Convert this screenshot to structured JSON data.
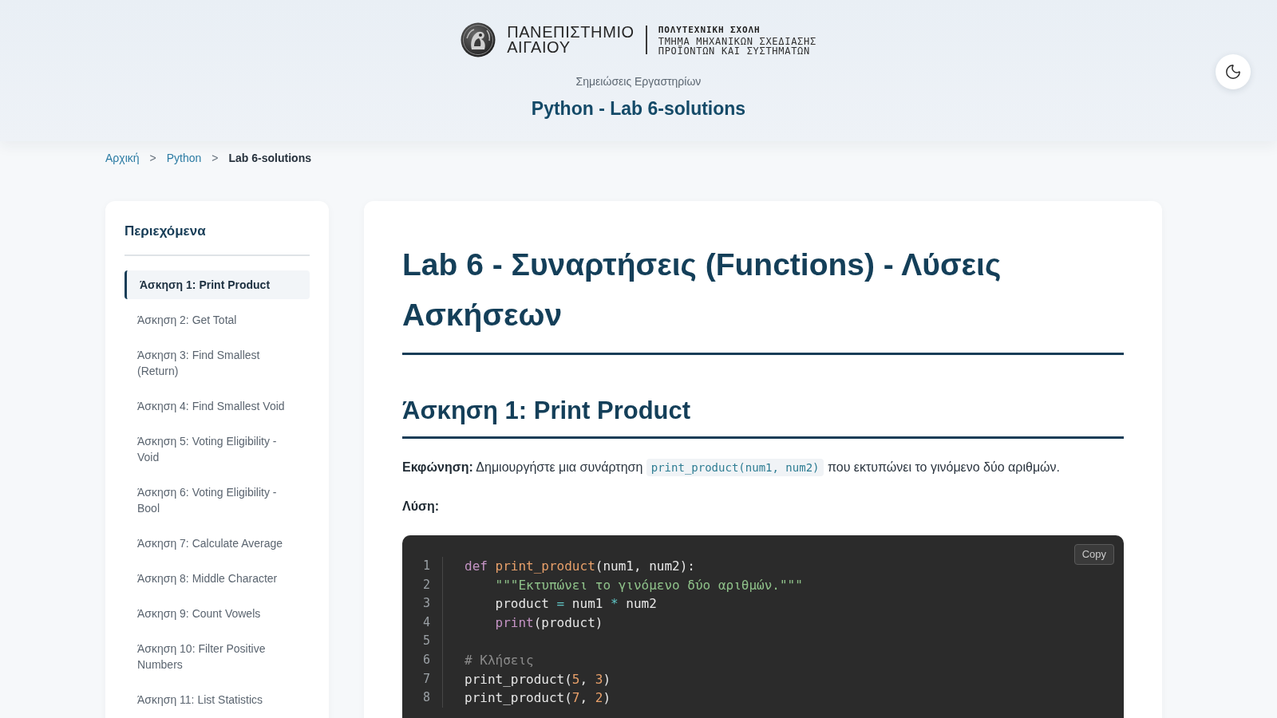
{
  "header": {
    "logo": {
      "name_lines": [
        "ΠΑΝΕΠΙΣΤΗΜΙΟ",
        "ΑΙΓΑΙΟΥ"
      ],
      "school": "ΠΟΛΥΤΕΧΝΙΚΗ ΣΧΟΛΗ",
      "department_lines": [
        "ΤΜΗΜΑ ΜΗΧΑΝΙΚΩΝ ΣΧΕΔΙΑΣΗΣ",
        "ΠΡΟΪΟΝΤΩΝ ΚΑΙ ΣΥΣΤΗΜΑΤΩΝ"
      ]
    },
    "subtitle": "Σημειώσεις Εργαστηρίων",
    "title": "Python - Lab 6-solutions"
  },
  "breadcrumb": [
    {
      "kind": "link",
      "label": "Αρχική"
    },
    {
      "kind": "separator",
      "label": ">"
    },
    {
      "kind": "link",
      "label": "Python"
    },
    {
      "kind": "separator",
      "label": ">"
    },
    {
      "kind": "current",
      "label": "Lab 6-solutions"
    }
  ],
  "sidebar": {
    "title": "Περιεχόμενα",
    "items": [
      {
        "label": "Άσκηση 1: Print Product",
        "selected": true
      },
      {
        "label": "Άσκηση 2: Get Total",
        "selected": false
      },
      {
        "label": "Άσκηση 3: Find Smallest (Return)",
        "selected": false
      },
      {
        "label": "Άσκηση 4: Find Smallest Void",
        "selected": false
      },
      {
        "label": "Άσκηση 5: Voting Eligibility - Void",
        "selected": false
      },
      {
        "label": "Άσκηση 6: Voting Eligibility - Bool",
        "selected": false
      },
      {
        "label": "Άσκηση 7: Calculate Average",
        "selected": false
      },
      {
        "label": "Άσκηση 8: Middle Character",
        "selected": false
      },
      {
        "label": "Άσκηση 9: Count Vowels",
        "selected": false
      },
      {
        "label": "Άσκηση 10: Filter Positive Numbers",
        "selected": false
      },
      {
        "label": "Άσκηση 11: List Statistics",
        "selected": false
      }
    ]
  },
  "article": {
    "title": "Lab 6 - Συναρτήσεις (Functions) - Λύσεις Ασκήσεων",
    "section": {
      "title": "Άσκηση 1: Print Product",
      "task": [
        {
          "kind": "label",
          "text": "Εκφώνηση:"
        },
        {
          "kind": "text",
          "text": "Δημιουργήστε μια συνάρτηση"
        },
        {
          "kind": "code",
          "text": "print_product(num1, num2)"
        },
        {
          "kind": "text",
          "text": "που εκτυπώνει το γινόμενο δύο αριθμών."
        }
      ],
      "solution_label": "Λύση:",
      "code": {
        "copy_button": "Copy",
        "lines": [
          {
            "number": "1",
            "tokens": [
              {
                "kind": "keyword",
                "text": "def"
              },
              {
                "kind": "function",
                "text": " print_product"
              },
              {
                "kind": "plain",
                "text": "(num1, num2):"
              }
            ]
          },
          {
            "number": "2",
            "tokens": [
              {
                "kind": "string",
                "text": "    \"\"\"Εκτυπώνει το γινόμενο δύο αριθμών.\"\"\""
              }
            ]
          },
          {
            "number": "3",
            "tokens": [
              {
                "kind": "plain",
                "text": "    product"
              },
              {
                "kind": "operator",
                "text": " ="
              },
              {
                "kind": "plain",
                "text": " num1"
              },
              {
                "kind": "operator",
                "text": " *"
              },
              {
                "kind": "plain",
                "text": " num2"
              }
            ]
          },
          {
            "number": "4",
            "tokens": [
              {
                "kind": "builtin",
                "text": "    print"
              },
              {
                "kind": "plain",
                "text": "(product)"
              }
            ]
          },
          {
            "number": "5"
          },
          {
            "number": "6",
            "tokens": [
              {
                "kind": "comment",
                "text": "# Κλήσεις"
              }
            ]
          },
          {
            "number": "7",
            "tokens": [
              {
                "kind": "plain",
                "text": "print_product("
              },
              {
                "kind": "number",
                "text": "5"
              },
              {
                "kind": "plain",
                "text": ", "
              },
              {
                "kind": "number",
                "text": "3"
              },
              {
                "kind": "plain",
                "text": ")"
              }
            ]
          },
          {
            "number": "8",
            "tokens": [
              {
                "kind": "plain",
                "text": "print_product("
              },
              {
                "kind": "number",
                "text": "7"
              },
              {
                "kind": "plain",
                "text": ", "
              },
              {
                "kind": "number",
                "text": "2"
              },
              {
                "kind": "plain",
                "text": ")"
              }
            ]
          }
        ]
      }
    }
  }
}
